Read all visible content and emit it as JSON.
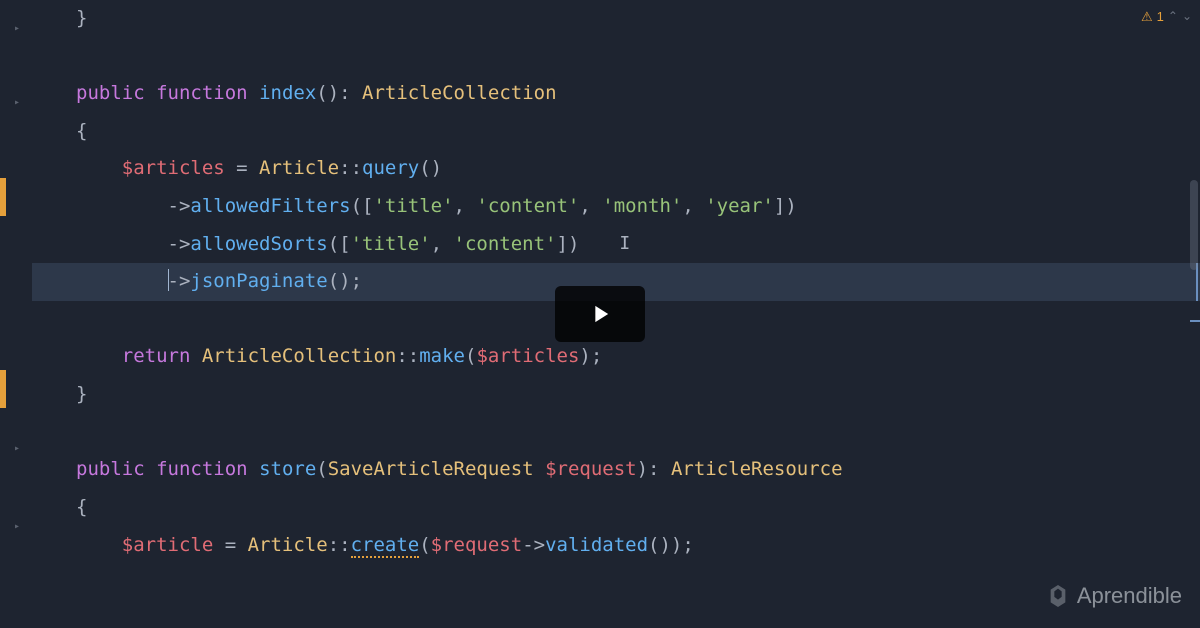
{
  "topright": {
    "warn_icon": "⚠",
    "warn_count": "1"
  },
  "watermark": {
    "text": "Aprendible"
  },
  "code": {
    "l1_brace": "}",
    "l3_public": "public",
    "l3_function": "function",
    "l3_name": "index",
    "l3_parens": "()",
    "l3_colon": ": ",
    "l3_return_type": "ArticleCollection",
    "l4_brace": "{",
    "l5_var": "$articles",
    "l5_eq": " = ",
    "l5_cls": "Article",
    "l5_scope": "::",
    "l5_query": "query",
    "l5_p": "()",
    "l6_arrow": "->",
    "l6_m": "allowedFilters",
    "l6_open": "([",
    "l6_s1": "'title'",
    "l6_c1": ", ",
    "l6_s2": "'content'",
    "l6_c2": ", ",
    "l6_s3": "'month'",
    "l6_c3": ", ",
    "l6_s4": "'year'",
    "l6_close": "])",
    "l7_arrow": "->",
    "l7_m": "allowedSorts",
    "l7_open": "([",
    "l7_s1": "'title'",
    "l7_c1": ", ",
    "l7_s2": "'content'",
    "l7_close": "])",
    "l8_arrow": "->",
    "l8_m": "jsonPaginate",
    "l8_p": "();",
    "l10_return": "return",
    "l10_cls": "ArticleCollection",
    "l10_scope": "::",
    "l10_make": "make",
    "l10_open": "(",
    "l10_var": "$articles",
    "l10_close": ");",
    "l11_brace": "}",
    "l13_public": "public",
    "l13_function": "function",
    "l13_name": "store",
    "l13_open": "(",
    "l13_type": "SaveArticleRequest",
    "l13_sp": " ",
    "l13_param": "$request",
    "l13_close": ")",
    "l13_colon": ": ",
    "l13_ret": "ArticleResource",
    "l14_brace": "{",
    "l15_var": "$article",
    "l15_eq": " = ",
    "l15_cls": "Article",
    "l15_scope": "::",
    "l15_create": "create",
    "l15_open": "(",
    "l15_req": "$request",
    "l15_arrow": "->",
    "l15_val": "validated",
    "l15_close": "());"
  }
}
